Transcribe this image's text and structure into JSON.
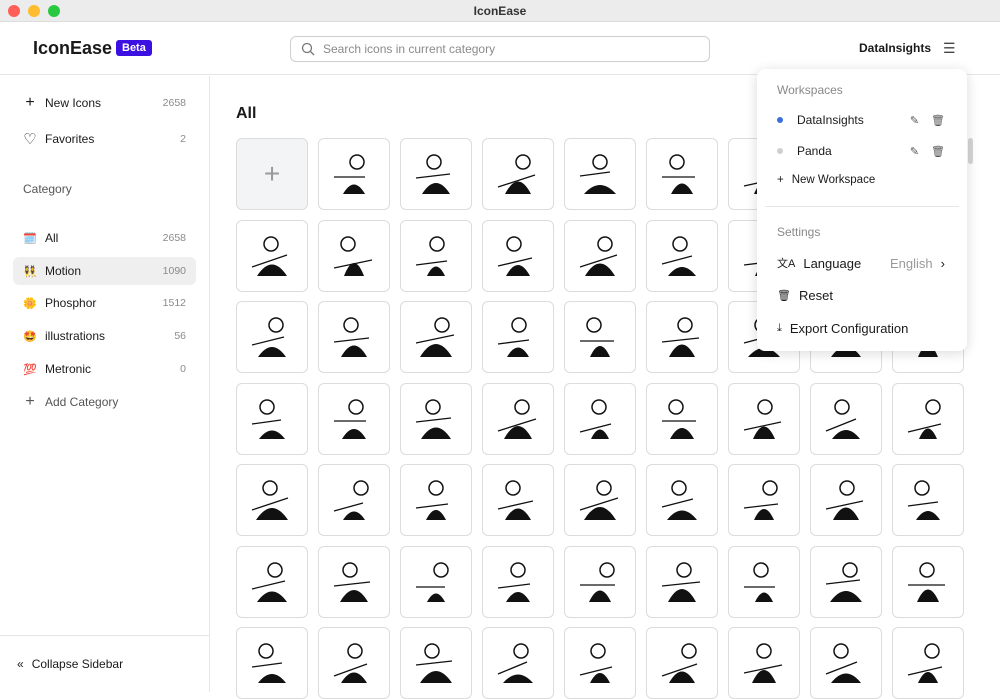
{
  "window": {
    "title": "IconEase"
  },
  "header": {
    "logo": "IconEase",
    "badge": "Beta",
    "search_placeholder": "Search icons in current category",
    "workspace": "DataInsights"
  },
  "sidebar": {
    "top": [
      {
        "label": "New Icons",
        "count": "2658",
        "icon": "plus-icon"
      },
      {
        "label": "Favorites",
        "count": "2",
        "icon": "heart-icon"
      }
    ],
    "category_heading": "Category",
    "categories": [
      {
        "label": "All",
        "count": "2658",
        "emoji": "🗓️",
        "active": false
      },
      {
        "label": "Motion",
        "count": "1090",
        "emoji": "👯",
        "active": true
      },
      {
        "label": "Phosphor",
        "count": "1512",
        "emoji": "🌼",
        "active": false
      },
      {
        "label": "illustrations",
        "count": "56",
        "emoji": "🤩",
        "active": false
      },
      {
        "label": "Metronic",
        "count": "0",
        "emoji": "💯",
        "active": false
      }
    ],
    "add_category": "Add Category",
    "collapse": "Collapse Sidebar"
  },
  "main": {
    "title": "All"
  },
  "dropdown": {
    "workspaces_heading": "Workspaces",
    "workspaces": [
      {
        "name": "DataInsights",
        "color": "#3b6fe0"
      },
      {
        "name": "Panda",
        "color": "#cfcfcf"
      }
    ],
    "new_workspace": "New Workspace",
    "settings_heading": "Settings",
    "language_label": "Language",
    "language_value": "English",
    "reset": "Reset",
    "export": "Export Configuration"
  }
}
